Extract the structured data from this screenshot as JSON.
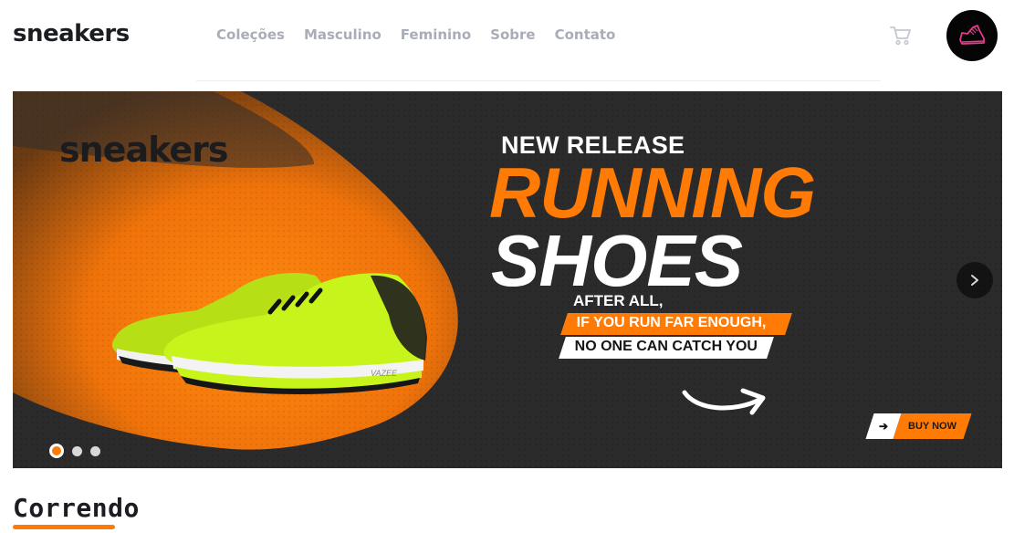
{
  "header": {
    "logo": "sneakers",
    "nav": [
      {
        "label": "Coleções"
      },
      {
        "label": "Masculino"
      },
      {
        "label": "Feminino"
      },
      {
        "label": "Sobre"
      },
      {
        "label": "Contato"
      }
    ],
    "cart_icon": "cart-icon",
    "avatar_icon": "sneaker-icon"
  },
  "banner": {
    "brand": "sneakers",
    "tagline_top": "NEW RELEASE",
    "headline_1": "RUNNING",
    "headline_2": "SHOES",
    "after": "AFTER ALL,",
    "strip_1": "IF YOU RUN FAR ENOUGH,",
    "strip_2": "NO ONE CAN CATCH YOU",
    "shoe_brand": "VAZEE",
    "cta": "BUY NOW",
    "cta_icon": "arrow-right-icon",
    "next_icon": "chevron-right-icon",
    "slides_total": 3,
    "active_slide": 1
  },
  "section": {
    "title": "Correndo"
  },
  "colors": {
    "accent": "#ff7b05",
    "banner_bg": "#2a2a2b",
    "nav_text": "#a9adb7",
    "shoe_green": "#c7f41b"
  }
}
